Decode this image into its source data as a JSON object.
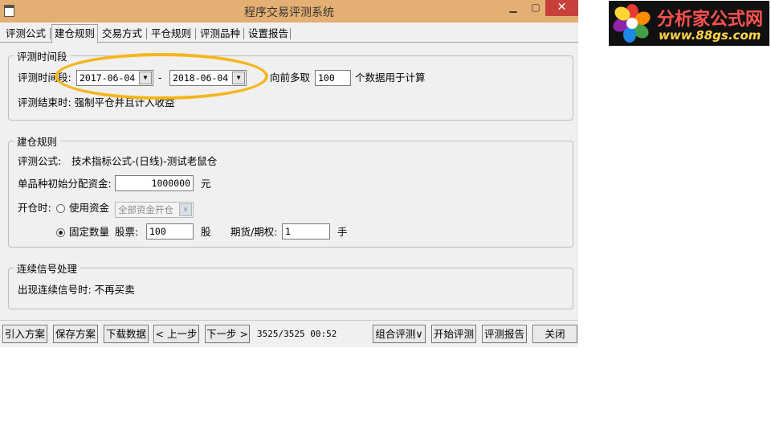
{
  "window": {
    "title": "程序交易评测系统",
    "controls": {
      "minimize": "▁",
      "maximize": "▢",
      "close": "✕"
    }
  },
  "tabs": [
    {
      "label": "评测公式",
      "active": false
    },
    {
      "label": "建仓规则",
      "active": true
    },
    {
      "label": "交易方式",
      "active": false
    },
    {
      "label": "平仓规则",
      "active": false
    },
    {
      "label": "评测品种",
      "active": false
    },
    {
      "label": "设置报告",
      "active": false
    }
  ],
  "period_group": {
    "legend": "评测时间段",
    "range_label": "评测时间段:",
    "start_date": "2017-06-04",
    "dash": "-",
    "end_date": "2018-06-04",
    "lookback_label": "向前多取",
    "lookback_value": "100",
    "lookback_suffix": "个数据用于计算",
    "end_rule": "评测结束时: 强制平仓并且计入收益"
  },
  "build_group": {
    "legend": "建仓规则",
    "formula_label": "评测公式:",
    "formula_value": "技术指标公式-(日线)-测试老鼠仓",
    "capital_label": "单品种初始分配资金:",
    "capital_value": "1000000",
    "capital_unit": "元",
    "open_label": "开仓时:",
    "use_capital_label": "使用资金",
    "use_capital_option": "全部资金开仓",
    "fixed_qty_label": "固定数量",
    "stock_label": "股票:",
    "stock_value": "100",
    "stock_unit": "股",
    "futures_label": "期货/期权:",
    "futures_value": "1",
    "futures_unit": "手",
    "selected_mode": "fixed_qty"
  },
  "signal_group": {
    "legend": "连续信号处理",
    "rule": "出现连续信号时: 不再买卖"
  },
  "bottom": {
    "import": "引入方案",
    "save": "保存方案",
    "download": "下载数据",
    "prev": "< 上一步",
    "next": "下一步 >",
    "status": "3525/3525 00:52",
    "combo": "组合评测∨",
    "start": "开始评测",
    "report": "评测报告",
    "close": "关闭"
  },
  "logo": {
    "title": "分析家公式网",
    "url": "www.88gs.com"
  },
  "colors": {
    "titlebar": "#e4af72",
    "close_button": "#c7403a",
    "annotation": "#f5b51a",
    "logo_title": "#ff5050",
    "logo_url": "#ffd54a"
  }
}
